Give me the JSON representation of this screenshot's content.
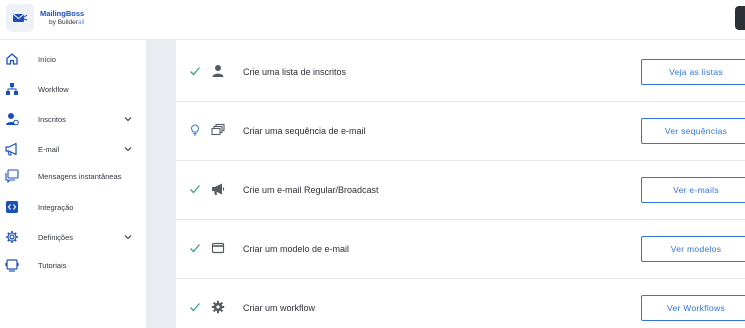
{
  "brand": {
    "name": "MailingBoss",
    "by": "by",
    "by_name": "Builder",
    "by_suffix": "all"
  },
  "sidebar": {
    "items": [
      {
        "label": "Início",
        "icon": "home-icon",
        "expandable": false
      },
      {
        "label": "Workflow",
        "icon": "workflow-icon",
        "expandable": false
      },
      {
        "label": "Inscritos",
        "icon": "subscribers-icon",
        "expandable": true
      },
      {
        "label": "E-mail",
        "icon": "megaphone-icon",
        "expandable": true
      },
      {
        "label": "Mensagens instantâneas",
        "icon": "chat-icon",
        "expandable": false
      },
      {
        "label": "Integração",
        "icon": "integration-icon",
        "expandable": false
      },
      {
        "label": "Definições",
        "icon": "gear-icon",
        "expandable": true
      },
      {
        "label": "Tutoriais",
        "icon": "tutorial-icon",
        "expandable": false
      }
    ]
  },
  "tasks": [
    {
      "status": "done",
      "status_icon": "check-icon",
      "icon": "person-icon",
      "label": "Crie uma lista de inscritos",
      "button": "Veja as listas"
    },
    {
      "status": "tip",
      "status_icon": "lightbulb-icon",
      "icon": "email-sequence-icon",
      "label": "Criar uma sequência de e-mail",
      "button": "Ver sequências"
    },
    {
      "status": "done",
      "status_icon": "check-icon",
      "icon": "megaphone-icon",
      "label": "Crie um e-mail Regular/Broadcast",
      "button": "Ver e-mails"
    },
    {
      "status": "done",
      "status_icon": "check-icon",
      "icon": "template-icon",
      "label": "Criar um modelo de e-mail",
      "button": "Ver modelos"
    },
    {
      "status": "done",
      "status_icon": "check-icon",
      "icon": "gear-icon",
      "label": "Criar um workflow",
      "button": "Ver Workflows"
    }
  ],
  "colors": {
    "accent": "#2f74e0",
    "sidebar_icon": "#1d4fb8",
    "check": "#3aa87a",
    "tip": "#2f74e0",
    "strip": "#e9ecf0"
  }
}
